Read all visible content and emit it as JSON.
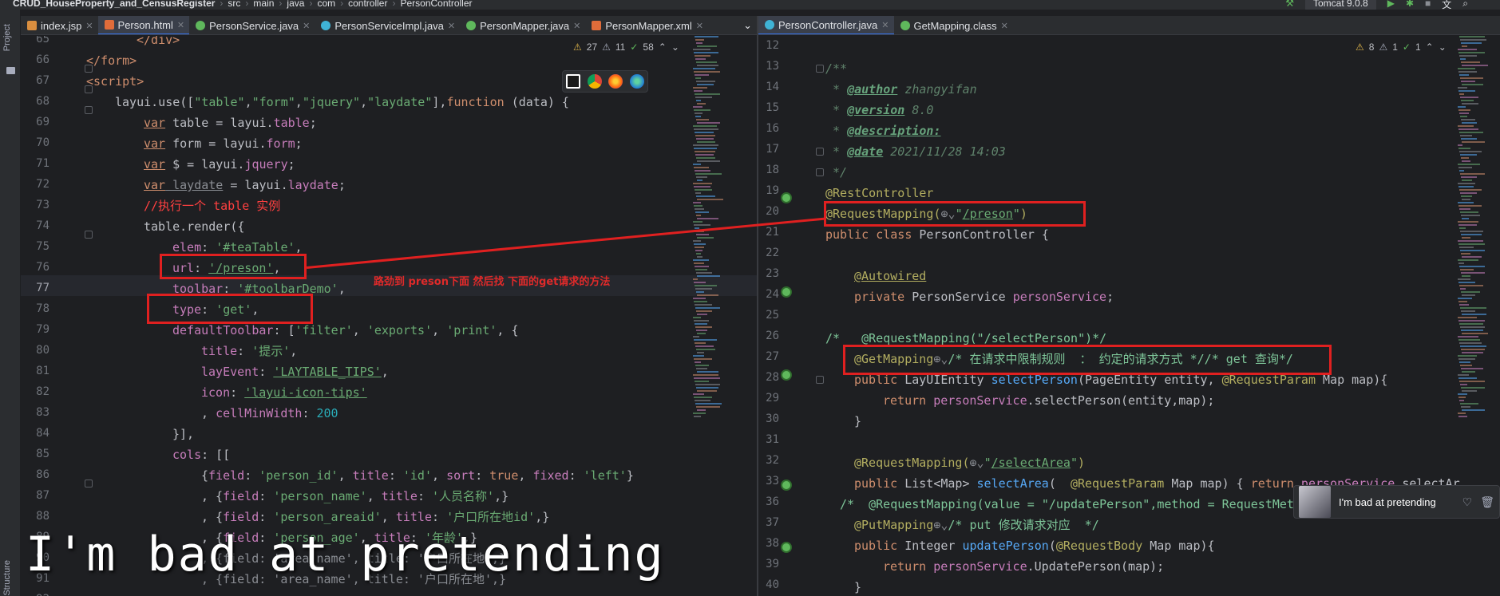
{
  "navbar": {
    "project": "CRUD_HouseProperty_and_CensusRegister",
    "path": [
      "src",
      "main",
      "java",
      "com",
      "controller",
      "PersonController"
    ],
    "run_config": "Tomcat 9.0.8"
  },
  "tool_windows": {
    "project": "Project",
    "structure": "Structure"
  },
  "left_tabs": [
    {
      "label": "index.jsp",
      "icon": "jsp-file-icon"
    },
    {
      "label": "Person.html",
      "icon": "html-file-icon"
    },
    {
      "label": "PersonService.java",
      "icon": "interface-icon"
    },
    {
      "label": "PersonServiceImpl.java",
      "icon": "class-icon"
    },
    {
      "label": "PersonMapper.java",
      "icon": "interface-icon"
    },
    {
      "label": "PersonMapper.xml",
      "icon": "xml-file-icon"
    }
  ],
  "right_tabs": [
    {
      "label": "PersonController.java",
      "icon": "class-icon"
    },
    {
      "label": "GetMapping.class",
      "icon": "annotation-icon"
    }
  ],
  "left_inspections": {
    "warnings": "27",
    "weak": "11",
    "ok": "58"
  },
  "right_inspections": {
    "warnings": "8",
    "weak": "1",
    "ok": "1"
  },
  "left_lines": [
    "65",
    "66",
    "67",
    "68",
    "69",
    "70",
    "71",
    "72",
    "73",
    "74",
    "75",
    "76",
    "77",
    "78",
    "79",
    "80",
    "81",
    "82",
    "83",
    "84",
    "85",
    "86",
    "87",
    "88",
    "89",
    "90",
    "91",
    "92"
  ],
  "right_lines": [
    "12",
    "13",
    "14",
    "15",
    "16",
    "17",
    "18",
    "19",
    "20",
    "21",
    "22",
    "23",
    "24",
    "25",
    "26",
    "27",
    "28",
    "29",
    "30",
    "31",
    "32",
    "33",
    "36",
    "37",
    "38",
    "39",
    "40"
  ],
  "left_code": {
    "l65": "</div>",
    "l66": "</form>",
    "l67": "<script>",
    "l68a": "layui.use([",
    "l68b": "\"table\"",
    "l68c": ",",
    "l68d": "\"form\"",
    "l68e": ",",
    "l68f": "\"jquery\"",
    "l68g": ",",
    "l68h": "\"laydate\"",
    "l68i": "],",
    "l68j": "function",
    "l68k": " (data) {",
    "l69a": "var",
    "l69b": " table = layui.",
    "l69c": "table",
    "l69d": ";",
    "l70a": "var",
    "l70b": " form = layui.",
    "l70c": "form",
    "l70d": ";",
    "l71a": "var",
    "l71b": " $ = layui.",
    "l71c": "jquery",
    "l71d": ";",
    "l72a": "var",
    "l72b": " laydate",
    "l72c": " = layui.",
    "l72d": "laydate",
    "l72e": ";",
    "l73": "//执行一个 table 实例",
    "l74": "table.render({",
    "l75a": "elem",
    "l75b": ": ",
    "l75c": "'#teaTable'",
    "l75d": ",",
    "l76a": "url",
    "l76b": ": ",
    "l76c": "'/preson'",
    "l76d": ",",
    "l77a": "toolbar",
    "l77b": ": ",
    "l77c": "'#toolbarDemo'",
    "l77d": ",",
    "l78a": "type",
    "l78b": ": ",
    "l78c": "'get'",
    "l78d": ",",
    "l79a": "defaultToolbar",
    "l79b": ": [",
    "l79c": "'filter'",
    "l79d": ", ",
    "l79e": "'exports'",
    "l79f": ", ",
    "l79g": "'print'",
    "l79h": ", {",
    "l80a": "title",
    "l80b": ": ",
    "l80c": "'提示'",
    "l80d": ",",
    "l81a": "layEvent",
    "l81b": ": ",
    "l81c": "'LAYTABLE_TIPS'",
    "l81d": ",",
    "l82a": "icon",
    "l82b": ": ",
    "l82c": "'layui-icon-tips'",
    "l83a": ", ",
    "l83b": "cellMinWidth",
    "l83c": ": ",
    "l83d": "200",
    "l84": "}],",
    "l85a": "cols",
    "l85b": ": [[",
    "l86a": "{",
    "l86b": "field",
    "l86c": ": ",
    "l86d": "'person_id'",
    "l86e": ", ",
    "l86f": "title",
    "l86g": ": ",
    "l86h": "'id'",
    "l86i": ", ",
    "l86j": "sort",
    "l86k": ": ",
    "l86l": "true",
    "l86m": ", ",
    "l86n": "fixed",
    "l86o": ": ",
    "l86p": "'left'",
    "l86q": "}",
    "l87a": ", {",
    "l87b": "field",
    "l87c": ": ",
    "l87d": "'person_name'",
    "l87e": ", ",
    "l87f": "title",
    "l87g": ": ",
    "l87h": "'人员名称'",
    "l87i": ",}",
    "l88a": ", {",
    "l88b": "field",
    "l88c": ": ",
    "l88d": "'person_areaid'",
    "l88e": ", ",
    "l88f": "title",
    "l88g": ": ",
    "l88h": "'户口所在地id'",
    "l88i": ",}",
    "l89a": ", {",
    "l89b": "field",
    "l89c": ": ",
    "l89d": "'person_age'",
    "l89e": ", ",
    "l89f": "title",
    "l89g": ": ",
    "l89h": "'年龄'",
    "l89i": ",}"
  },
  "right_code": {
    "r13": "/**",
    "r14a": " * ",
    "r14b": "@author",
    "r14c": " zhangyifan",
    "r15a": " * ",
    "r15b": "@version",
    "r15c": " 8.0",
    "r16a": " * ",
    "r16b": "@description:",
    "r17a": " * ",
    "r17b": "@date",
    "r17c": " 2021/11/28 14:03",
    "r18": " */",
    "r19": "@RestController",
    "r20a": "@RequestMapping(",
    "r20b": "\"",
    "r20c": "/preson",
    "r20d": "\"",
    "r20e": ")",
    "r21a": "public class",
    "r21b": " PersonController {",
    "r23": "@Autowired",
    "r24a": "private",
    "r24b": " PersonService ",
    "r24c": "personService",
    "r24d": ";",
    "r26": "/*   @RequestMapping(\"/selectPerson\")*/",
    "r27a": "@GetMapping",
    "r27b": "/* 在请求中限制规则  ： 约定的请求方式 *//* get 查询*/",
    "r28a": "public",
    "r28b": " LayUIEntity ",
    "r28c": "selectPerson",
    "r28d": "(PageEntity entity, ",
    "r28e": "@RequestParam",
    "r28f": " Map map){",
    "r29a": "return",
    "r29b": " personService",
    "r29c": ".selectPerson(entity,map);",
    "r30": "}",
    "r32a": "@RequestMapping(",
    "r32b": "\"",
    "r32c": "/selectArea",
    "r32d": "\"",
    "r32e": ")",
    "r33a": "public",
    "r33b": " List<Map> ",
    "r33c": "selectArea",
    "r33d": "(  ",
    "r33e": "@RequestParam",
    "r33f": " Map map) { ",
    "r33g": "return",
    "r33h": " personService",
    "r33i": ".selectAr",
    "r36": "/*  @RequestMapping(value = \"/updatePerson\",method = RequestMet",
    "r37a": "@PutMapping",
    "r37b": "/* put 修改请求对应  */",
    "r38a": "public",
    "r38b": " Integer ",
    "r38c": "updatePerson",
    "r38d": "(",
    "r38e": "@RequestBody",
    "r38f": " Map map){",
    "r39a": "return",
    "r39b": " personService",
    "r39c": ".UpdatePerson(map);",
    "r40": "}"
  },
  "annotation_note": "路劲到 preson下面  然后找 下面的get请求的方法",
  "lyrics": "I'm bad at pretending",
  "player": {
    "title": "I'm bad at pretending"
  },
  "colors": {
    "annotation_red": "#e02020",
    "editor_bg": "#1e1f22",
    "accent": "#3574f0"
  }
}
